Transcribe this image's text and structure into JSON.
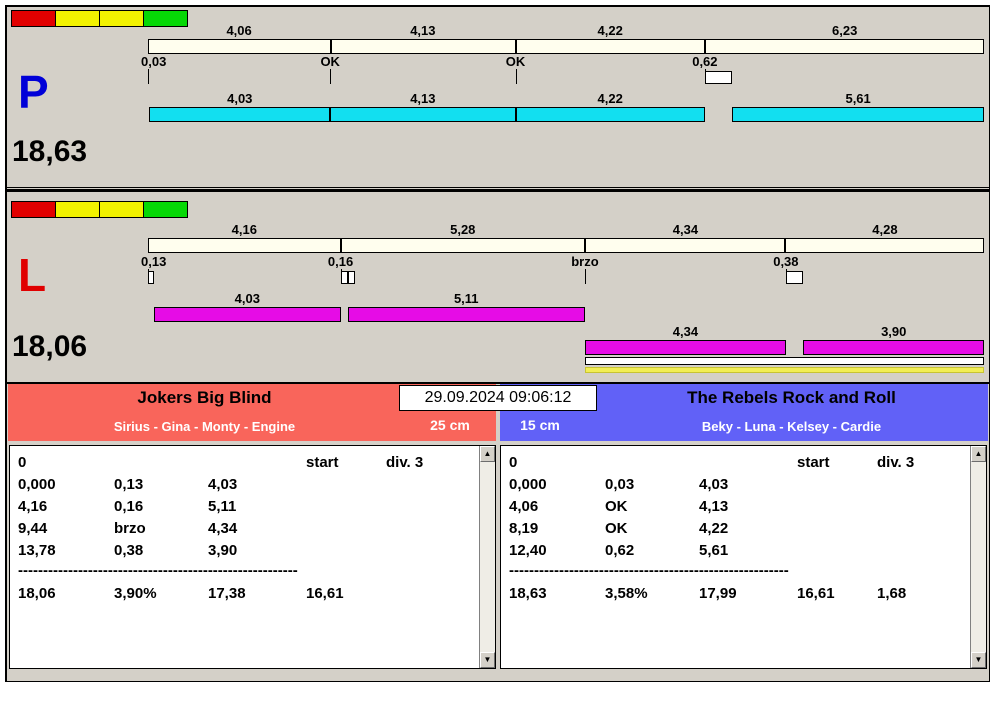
{
  "colors": {
    "window_bg": "#d4d0c8",
    "cream_bar": "#fffeee",
    "cyan_bar": "#12dff0",
    "magenta_bar": "#e60ce6",
    "header_red": "#f9655b",
    "header_blue": "#6161f7"
  },
  "icons": {
    "scroll_up": "▲",
    "scroll_down": "▼"
  },
  "panels": [
    {
      "id": "P",
      "letter": "P",
      "letter_color": "#0000d8",
      "total_label": "18,63",
      "total_value": 18.63,
      "flags": [
        "#e10000",
        "#f2f200",
        "#f2f200",
        "#06d806"
      ],
      "top_bar": {
        "labels": [
          "4,06",
          "4,13",
          "4,22",
          "6,23"
        ],
        "segments": [
          4.06,
          4.13,
          4.22,
          6.23
        ]
      },
      "ticks": [
        {
          "label": "0,03",
          "pos": 0
        },
        {
          "label": "OK",
          "pos": 4.06
        },
        {
          "label": "OK",
          "pos": 8.19
        },
        {
          "label": "0,62",
          "pos": 12.41,
          "box": {
            "len": 0.62
          }
        }
      ],
      "bar_rows": [
        {
          "color": "#12dff0",
          "segments": [
            {
              "start": 0.03,
              "len": 4.03,
              "label": "4,03"
            },
            {
              "start": 4.06,
              "len": 4.13,
              "label": "4,13"
            },
            {
              "start": 8.19,
              "len": 4.22,
              "label": "4,22"
            },
            {
              "start": 13.02,
              "len": 5.61,
              "label": "5,61"
            }
          ]
        }
      ]
    },
    {
      "id": "L",
      "letter": "L",
      "letter_color": "#e00000",
      "total_label": "18,06",
      "total_value": 18.06,
      "flags": [
        "#e10000",
        "#f2f200",
        "#f2f200",
        "#06d806"
      ],
      "top_bar": {
        "labels": [
          "4,16",
          "5,28",
          "4,34",
          "4,28"
        ],
        "segments": [
          4.16,
          5.28,
          4.34,
          4.28
        ]
      },
      "ticks": [
        {
          "label": "0,13",
          "pos": 0,
          "box": {
            "len": 0.13
          }
        },
        {
          "label": "0,16",
          "pos": 4.16,
          "box": {
            "len": 0.16,
            "double": true
          }
        },
        {
          "label": "brzo",
          "pos": 9.44
        },
        {
          "label": "0,38",
          "pos": 13.78,
          "box": {
            "len": 0.38
          }
        }
      ],
      "bar_rows": [
        {
          "color": "#e60ce6",
          "segments": [
            {
              "start": 0.13,
              "len": 4.03,
              "label": "4,03"
            },
            {
              "start": 4.32,
              "len": 5.11,
              "label": "5,11"
            }
          ]
        },
        {
          "color": "#e60ce6",
          "segments": [
            {
              "start": 9.44,
              "len": 4.34,
              "label": "4,34"
            },
            {
              "start": 14.16,
              "len": 3.9,
              "label": "3,90"
            }
          ]
        },
        {
          "color": "#ffffff",
          "thin": true,
          "height": 8,
          "segments": [
            {
              "start": 9.44,
              "len": 8.62
            }
          ]
        },
        {
          "color": "#f2ee55",
          "thin": true,
          "height": 6,
          "border": "#c8c432",
          "segments": [
            {
              "start": 9.44,
              "len": 8.62
            }
          ]
        }
      ]
    }
  ],
  "scoreboard": {
    "datetime": "29.09.2024 09:06:12",
    "left": {
      "team": "Jokers Big Blind",
      "members": "Sirius - Gina - Monty - Engine",
      "cm": "25 cm",
      "table": {
        "header": [
          "0",
          "",
          "",
          "start",
          "div. 3"
        ],
        "rows": [
          [
            "0,000",
            "0,13",
            "4,03"
          ],
          [
            "4,16",
            "0,16",
            "5,11"
          ],
          [
            "9,44",
            "brzo",
            "4,34"
          ],
          [
            "13,78",
            "0,38",
            "3,90"
          ]
        ],
        "divider": "--------------------------------------------------------",
        "totals": [
          "18,06",
          "3,90%",
          "17,38",
          "16,61",
          ""
        ]
      }
    },
    "right": {
      "team": "The Rebels Rock and Roll",
      "members": "Beky - Luna - Kelsey - Cardie",
      "cm": "15 cm",
      "table": {
        "header": [
          "0",
          "",
          "",
          "start",
          "div. 3"
        ],
        "rows": [
          [
            "0,000",
            "0,03",
            "4,03"
          ],
          [
            "4,06",
            "OK",
            "4,13"
          ],
          [
            "8,19",
            "OK",
            "4,22"
          ],
          [
            "12,40",
            "0,62",
            "5,61"
          ]
        ],
        "divider": "--------------------------------------------------------",
        "totals": [
          "18,63",
          "3,58%",
          "17,99",
          "16,61",
          "1,68"
        ]
      }
    }
  }
}
